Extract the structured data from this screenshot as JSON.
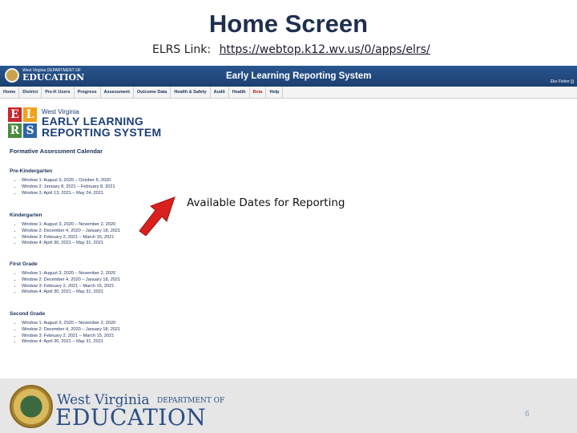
{
  "slide": {
    "title": "Home Screen",
    "link_label": "ELRS Link:",
    "link_url": "https://webtop.k12.wv.us/0/apps/elrs/"
  },
  "app": {
    "logo_line1": "West Virginia DEPARTMENT OF",
    "logo_line2": "EDUCATION",
    "system_title": "Early Learning Reporting System",
    "user_name": "Eko Fisher [j]",
    "nav": [
      "Home",
      "District",
      "Pre-K Users",
      "Progress",
      "Assessment",
      "Outcome Data",
      "Health & Safety",
      "Audit",
      "Health",
      "Beta",
      "Help"
    ]
  },
  "elrs_logo": {
    "tiles": [
      "E",
      "L",
      "R",
      "S"
    ],
    "state": "West Virginia",
    "line1": "EARLY LEARNING",
    "line2": "REPORTING SYSTEM"
  },
  "calendar": {
    "title": "Formative Assessment Calendar",
    "grades": [
      {
        "name": "Pre-Kindergarten",
        "windows": [
          "Window 1: August 3, 2020 – October 5, 2020",
          "Window 2: January 8, 2021 – February 8, 2021",
          "Window 3: April 13, 2021 – May 24, 2021"
        ]
      },
      {
        "name": "Kindergarten",
        "windows": [
          "Window 1: August 3, 2020 – November 2, 2020",
          "Window 2: December 4, 2020 – January 18, 2021",
          "Window 3: February 2, 2021 – March 15, 2021",
          "Window 4: April 30, 2021 – May 31, 2021"
        ]
      },
      {
        "name": "First Grade",
        "windows": [
          "Window 1: August 3, 2020 – November 2, 2020",
          "Window 2: December 4, 2020 – January 18, 2021",
          "Window 3: February 2, 2021 – March 15, 2021",
          "Window 4: April 30, 2021 – May 31, 2021"
        ]
      },
      {
        "name": "Second Grade",
        "windows": [
          "Window 1: August 3, 2020 – November 2, 2020",
          "Window 2: December 4, 2020 – January 18, 2021",
          "Window 3: February 2, 2021 – March 15, 2021",
          "Window 4: April 30, 2021 – May 31, 2021"
        ]
      }
    ]
  },
  "callout": "Available Dates for Reporting",
  "footer": {
    "wv": "West Virginia",
    "dept": "DEPARTMENT OF",
    "edu": "EDUCATION",
    "page_number": "6"
  },
  "colors": {
    "header_blue": "#1c3f70",
    "arrow_red": "#d8201e",
    "brand_blue": "#2b4f86"
  }
}
